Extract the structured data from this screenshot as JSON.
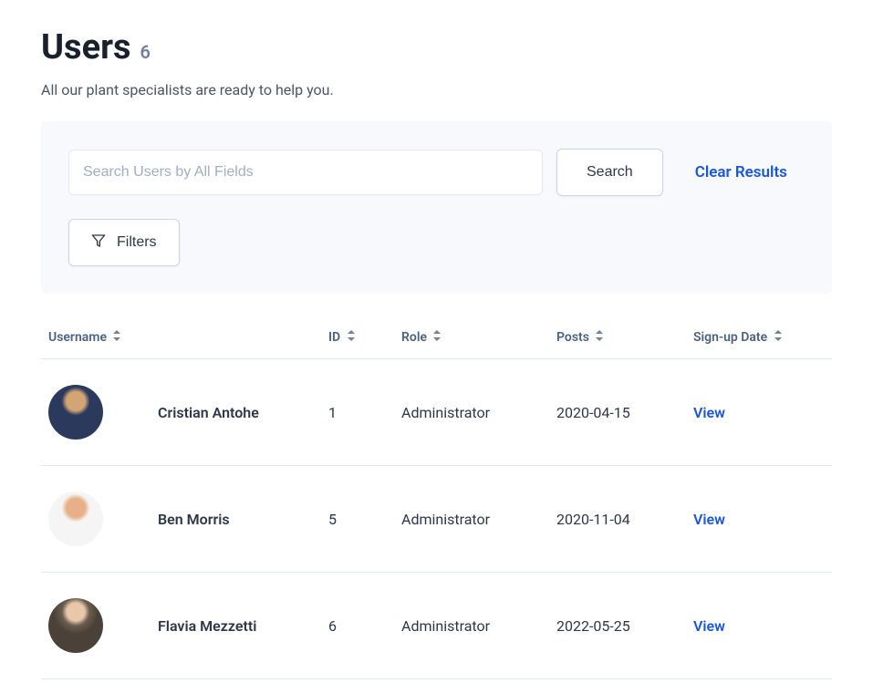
{
  "header": {
    "title": "Users",
    "count": "6",
    "subtitle": "All our plant specialists are ready to help you."
  },
  "search": {
    "placeholder": "Search Users by All Fields",
    "search_label": "Search",
    "clear_label": "Clear Results",
    "filters_label": "Filters"
  },
  "table": {
    "columns": {
      "username": "Username",
      "id": "ID",
      "role": "Role",
      "posts": "Posts",
      "signup": "Sign-up Date"
    },
    "view_label": "View",
    "rows": [
      {
        "username": "Cristian Antohe",
        "id": "1",
        "role": "Administrator",
        "posts": "2020-04-15"
      },
      {
        "username": "Ben Morris",
        "id": "5",
        "role": "Administrator",
        "posts": "2020-11-04"
      },
      {
        "username": "Flavia Mezzetti",
        "id": "6",
        "role": "Administrator",
        "posts": "2022-05-25"
      }
    ]
  }
}
